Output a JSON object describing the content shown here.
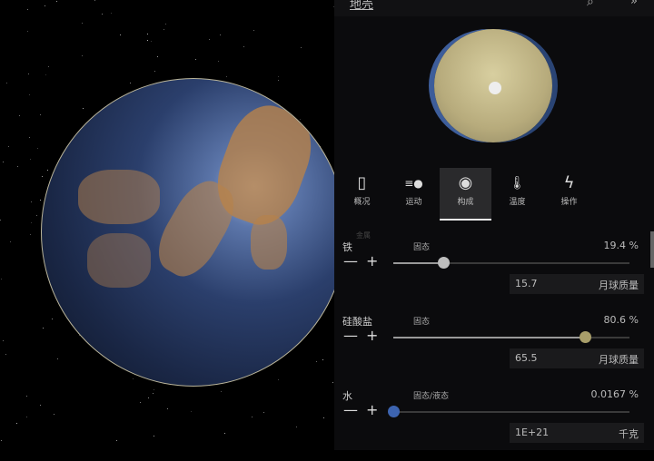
{
  "header": {
    "title": "地壳",
    "search_icon": "search-icon",
    "more_icon": "chevrons-icon"
  },
  "tabs": [
    {
      "label": "概况",
      "icon": "bookmark-icon",
      "glyph": "▯"
    },
    {
      "label": "运动",
      "icon": "motion-icon",
      "glyph": "≡●"
    },
    {
      "label": "构成",
      "icon": "composition-icon",
      "glyph": "◉",
      "active": true
    },
    {
      "label": "温度",
      "icon": "thermometer-icon",
      "glyph": "🌡"
    },
    {
      "label": "操作",
      "icon": "lightning-icon",
      "glyph": "ϟ"
    }
  ],
  "faint_label": "金属",
  "materials": [
    {
      "name": "铁",
      "state": "固态",
      "percent": "19.4 %",
      "slider": 0.21,
      "color": "#bdbdbd",
      "mass": "15.7",
      "unit": "月球质量"
    },
    {
      "name": "硅酸盐",
      "state": "固态",
      "percent": "80.6 %",
      "slider": 0.81,
      "color": "#a89e6a",
      "mass": "65.5",
      "unit": "月球质量"
    },
    {
      "name": "水",
      "state": "固态/液态",
      "percent": "0.0167 %",
      "slider": 0.0,
      "color": "#3d64b0",
      "mass": "1E+21",
      "unit": "千克"
    }
  ],
  "symbols": {
    "minus": "—",
    "plus": "+",
    "search": "⌕",
    "more": "»"
  }
}
